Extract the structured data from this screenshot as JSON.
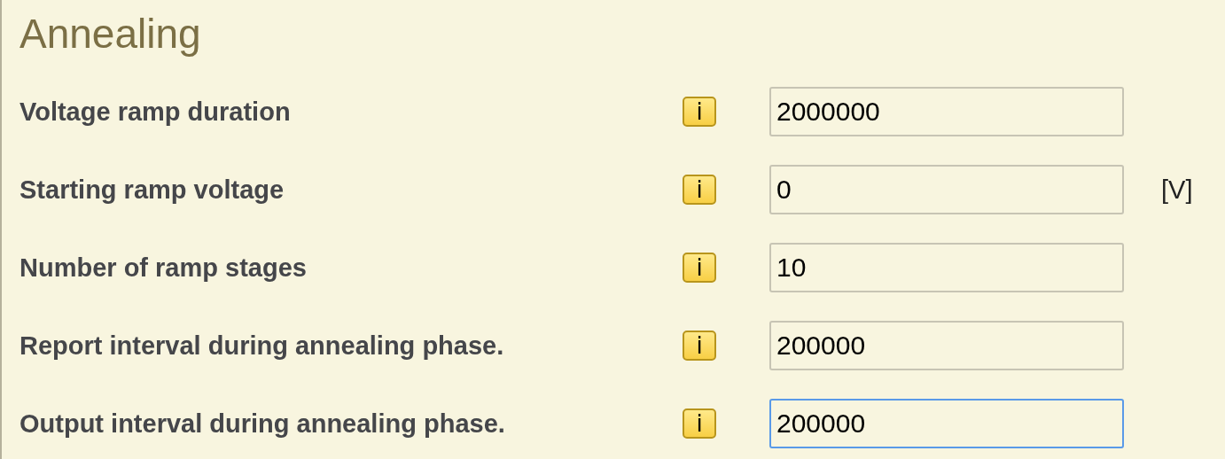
{
  "section": {
    "title": "Annealing"
  },
  "fields": [
    {
      "label": "Voltage ramp duration",
      "info": "i",
      "value": "2000000",
      "focused": false
    },
    {
      "label": "Starting ramp voltage",
      "info": "i",
      "value": "0",
      "unit": "[V]",
      "focused": false
    },
    {
      "label": "Number of ramp stages",
      "info": "i",
      "value": "10",
      "focused": false
    },
    {
      "label": "Report interval during annealing phase.",
      "info": "i",
      "value": "200000",
      "focused": false
    },
    {
      "label": "Output interval during annealing phase.",
      "info": "i",
      "value": "200000",
      "focused": true
    }
  ]
}
